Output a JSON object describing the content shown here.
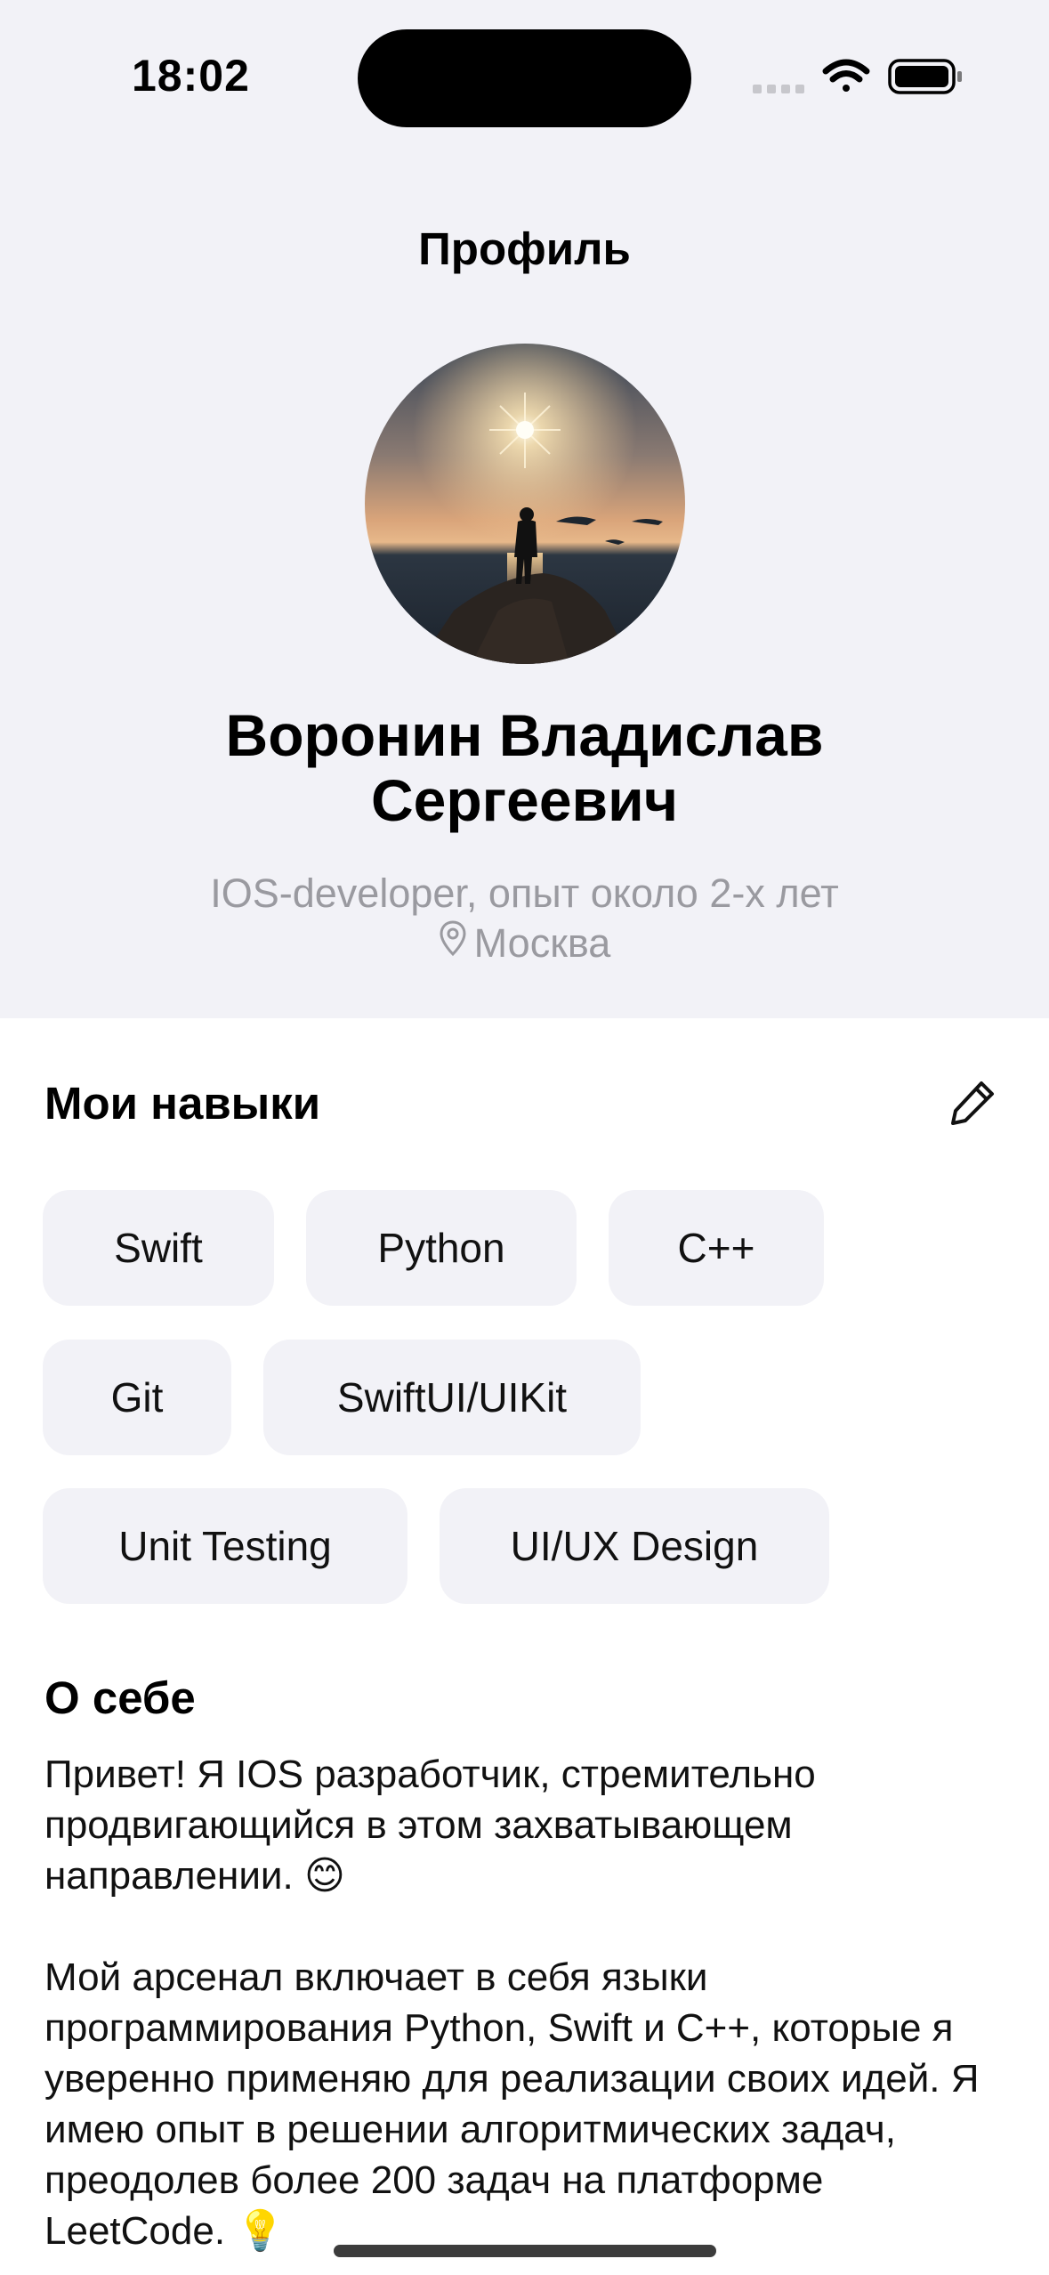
{
  "status_bar": {
    "time": "18:02"
  },
  "nav": {
    "title": "Профиль"
  },
  "profile": {
    "name_line1": "Воронин Владислав",
    "name_line2": "Сергеевич",
    "role": "IOS-developer, опыт около 2-х лет",
    "location": "Москва"
  },
  "skills": {
    "title": "Мои навыки",
    "items": [
      "Swift",
      "Python",
      "C++",
      "Git",
      "SwiftUI/UIKit",
      "Unit Testing",
      "UI/UX Design"
    ]
  },
  "about": {
    "title": "О себе",
    "paragraph1": "Привет! Я IOS разработчик, стремительно продвигающийся в этом захватывающем направлении. 😊",
    "paragraph2": "Мой арсенал включает в себя языки программирования Python, Swift и C++, которые я уверенно применяю для реализации своих идей. Я имею опыт в решении алгоритмических задач, преодолев более 200 задач на платформе LeetCode. 💡"
  },
  "colors": {
    "top_background": "#f2f2f7",
    "chip_background": "#f2f2f7",
    "secondary_text": "#9a9aa0"
  },
  "icons": {
    "location": "location-pin-icon",
    "edit": "pencil-icon",
    "wifi": "wifi-icon",
    "battery": "battery-icon",
    "signal": "cellular-signal-icon"
  }
}
